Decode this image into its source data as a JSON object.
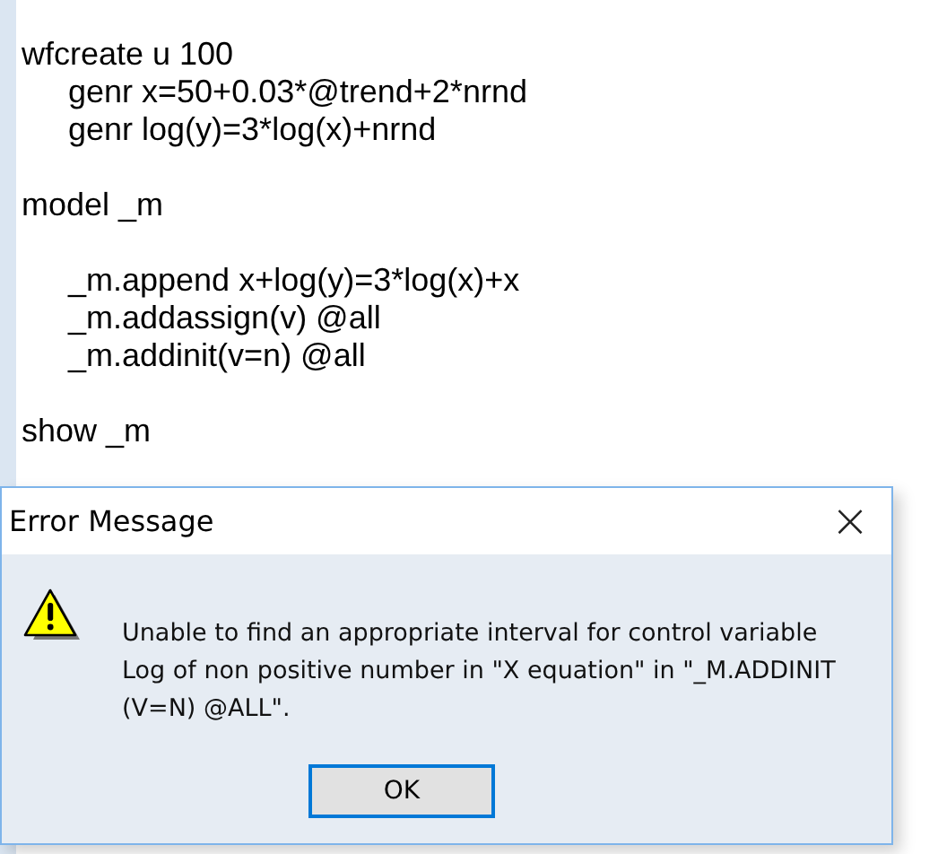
{
  "editor": {
    "blocks": [
      {
        "lines": [
          {
            "text": "wfcreate u 100",
            "children": [
              {
                "text": "genr x=50+0.03*@trend+2*nrnd"
              },
              {
                "text": "genr log(y)=3*log(x)+nrnd"
              }
            ]
          }
        ]
      },
      {
        "lines": [
          {
            "text": "model _m"
          }
        ]
      },
      {
        "lines": [
          {
            "children": [
              {
                "text": "_m.append x+log(y)=3*log(x)+x"
              },
              {
                "text": "_m.addassign(v) @all"
              },
              {
                "text": "_m.addinit(v=n) @all"
              }
            ]
          }
        ]
      },
      {
        "lines": [
          {
            "text": "show _m"
          }
        ]
      }
    ]
  },
  "dialog": {
    "title": "Error Message",
    "close": "×",
    "message_lines": [
      "Unable to find an appropriate interval for control variable",
      "Log of non positive number in \"X equation\" in \"_M.ADDINIT",
      "(V=N) @ALL\"."
    ],
    "buttons": [
      "OK"
    ]
  }
}
